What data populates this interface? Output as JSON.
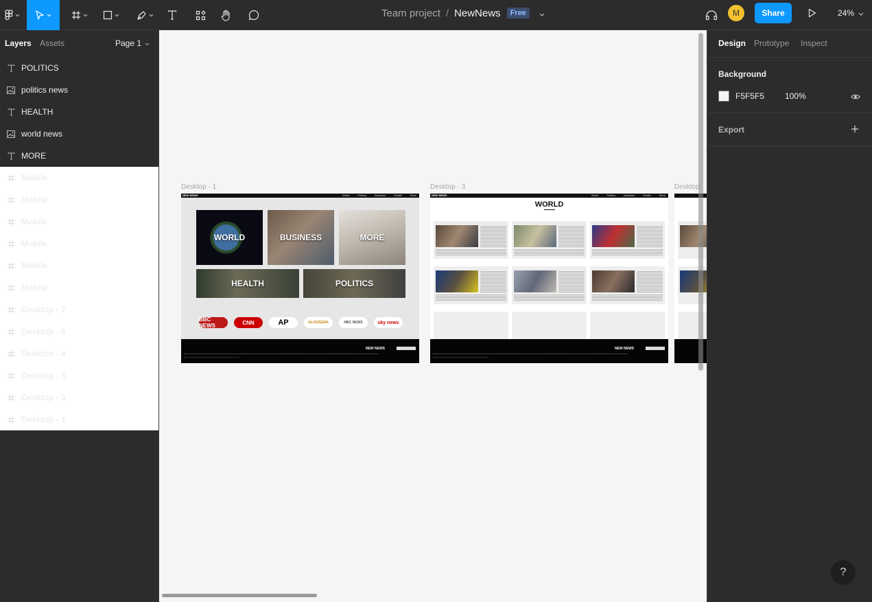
{
  "toolbar": {
    "project": "Team project",
    "separator": "/",
    "file_name": "NewNews",
    "plan_badge": "Free",
    "avatar_initial": "M",
    "share_label": "Share",
    "zoom": "24%",
    "accent_color": "#0d99ff",
    "icons": [
      "figma-menu-icon",
      "move-tool-icon",
      "frame-tool-icon",
      "shape-tool-icon",
      "pen-tool-icon",
      "text-tool-icon",
      "resources-icon",
      "hand-tool-icon",
      "comment-icon",
      "headphones-icon",
      "play-icon"
    ]
  },
  "left_panel": {
    "tabs": [
      "Layers",
      "Assets"
    ],
    "page": "Page 1",
    "layers": [
      {
        "name": "POLITICS",
        "type": "text"
      },
      {
        "name": "politics news",
        "type": "image"
      },
      {
        "name": "HEALTH",
        "type": "text"
      },
      {
        "name": "world news",
        "type": "image"
      },
      {
        "name": "MORE",
        "type": "text"
      },
      {
        "name": "Mobile",
        "type": "frame"
      },
      {
        "name": "Mobile",
        "type": "frame"
      },
      {
        "name": "Mobile",
        "type": "frame"
      },
      {
        "name": "Mobile",
        "type": "frame"
      },
      {
        "name": "Mobile",
        "type": "frame"
      },
      {
        "name": "Mobile",
        "type": "frame"
      },
      {
        "name": "Desktop - 7",
        "type": "frame"
      },
      {
        "name": "Desktop - 6",
        "type": "frame"
      },
      {
        "name": "Desktop - 4",
        "type": "frame"
      },
      {
        "name": "Desktop - 5",
        "type": "frame"
      },
      {
        "name": "Desktop - 3",
        "type": "frame"
      },
      {
        "name": "Desktop - 1",
        "type": "frame"
      }
    ]
  },
  "canvas": {
    "background": "#F5F5F5",
    "frame_labels": [
      "Desktop - 1",
      "Desktop - 3",
      "Desktop"
    ],
    "desktop1": {
      "logo": "NEW NEWS",
      "nav_links": [
        "World",
        "Politics",
        "Business",
        "Health",
        "More"
      ],
      "tiles": [
        "WORLD",
        "BUSINESS",
        "MORE",
        "HEALTH",
        "POLITICS"
      ],
      "sources": [
        "BBC NEWS",
        "CNN",
        "AP",
        "ALJAZEERA",
        "NBC NEWS",
        "sky news"
      ],
      "footer_logo": "NEW NEWS"
    },
    "desktop3": {
      "logo": "NEW NEWS",
      "heading": "WORLD",
      "nav_links": [
        "World",
        "Politics",
        "Business",
        "Health",
        "More"
      ],
      "footer_logo": "NEW NEWS"
    }
  },
  "right_panel": {
    "tabs": [
      "Design",
      "Prototype",
      "Inspect"
    ],
    "background_label": "Background",
    "background_hex": "F5F5F5",
    "background_opacity": "100%",
    "export_label": "Export"
  },
  "help": "?"
}
